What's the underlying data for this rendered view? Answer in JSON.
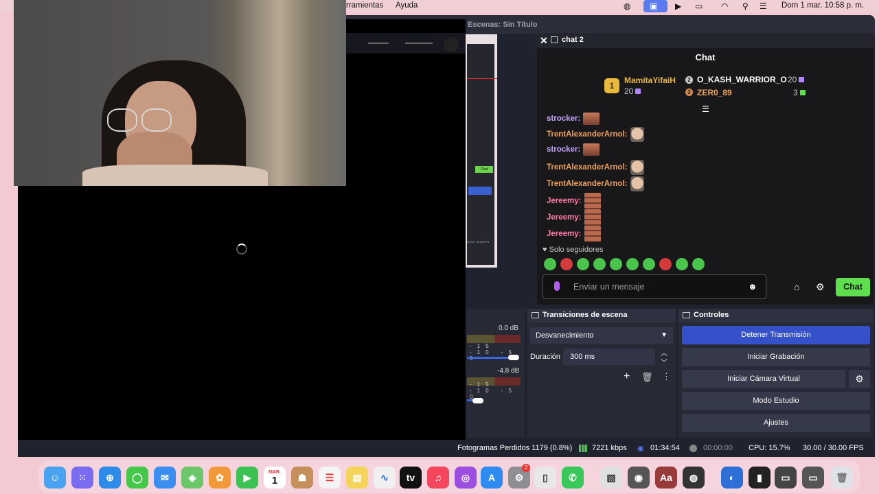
{
  "menubar": {
    "menu_herramientas": "rramientas",
    "menu_ayuda": "Ayuda",
    "clock": "Dom 1 mar.  10:58 p. m."
  },
  "obs": {
    "title": "Escenas: Sin Título"
  },
  "chat": {
    "tab_label": "chat 2",
    "title": "Chat",
    "leaderboard": {
      "first_name": "MamitaYifaiH",
      "first_count": "20",
      "first_rank": "1",
      "second_name": "O_KASH_WARRIOR_O",
      "second_count": "20",
      "third_name": "ZER0_89",
      "third_count": "3"
    },
    "messages": [
      {
        "user": "strocker:",
        "color": "#c9a6ff"
      },
      {
        "user": "TrentAlexanderArnol:",
        "color": "#f0a35a"
      },
      {
        "user": "strocker:",
        "color": "#c9a6ff"
      },
      {
        "user": "TrentAlexanderArnol:",
        "color": "#f0a35a"
      },
      {
        "user": "TrentAlexanderArnol:",
        "color": "#f0a35a"
      },
      {
        "user": "Jereemy:",
        "color": "#ff7ea8"
      },
      {
        "user": "Jereemy:",
        "color": "#ff7ea8"
      },
      {
        "user": "Jereemy:",
        "color": "#ff7ea8"
      }
    ],
    "followers_only": "Solo seguidores",
    "input_placeholder": "Enviar un mensaje",
    "send_label": "Chat"
  },
  "audio": {
    "level1": "0.0 dB",
    "level2": "-4.8 dB",
    "ticks": "-15 -10 -5 0"
  },
  "transitions": {
    "title": "Transiciones de escena",
    "selected": "Desvanecimiento",
    "duration_label": "Duración",
    "duration_value": "300 ms"
  },
  "controls": {
    "title": "Controles",
    "stop_stream": "Detener Transmisión",
    "start_recording": "Iniciar Grabación",
    "start_virtual_cam": "Iniciar Cámara Virtual",
    "studio_mode": "Modo Estudio",
    "settings": "Ajustes"
  },
  "status": {
    "dropped_frames": "Fotogramas Perdidos 1179 (0.8%)",
    "bitrate": "7221 kbps",
    "stream_time": "01:34:54",
    "rec_time": "00:00:00",
    "cpu": "CPU: 15.7%",
    "fps": "30.00 / 30.00 FPS"
  },
  "dock": {
    "calendar_month": "MAR.",
    "calendar_day": "1",
    "appstore_badge": "2",
    "dictionary_label": "Aa",
    "tv_label": "tv"
  },
  "colors": {
    "accent_blue": "#3451c9",
    "chat_green": "#5ee04e",
    "gold": "#e9b93b"
  }
}
